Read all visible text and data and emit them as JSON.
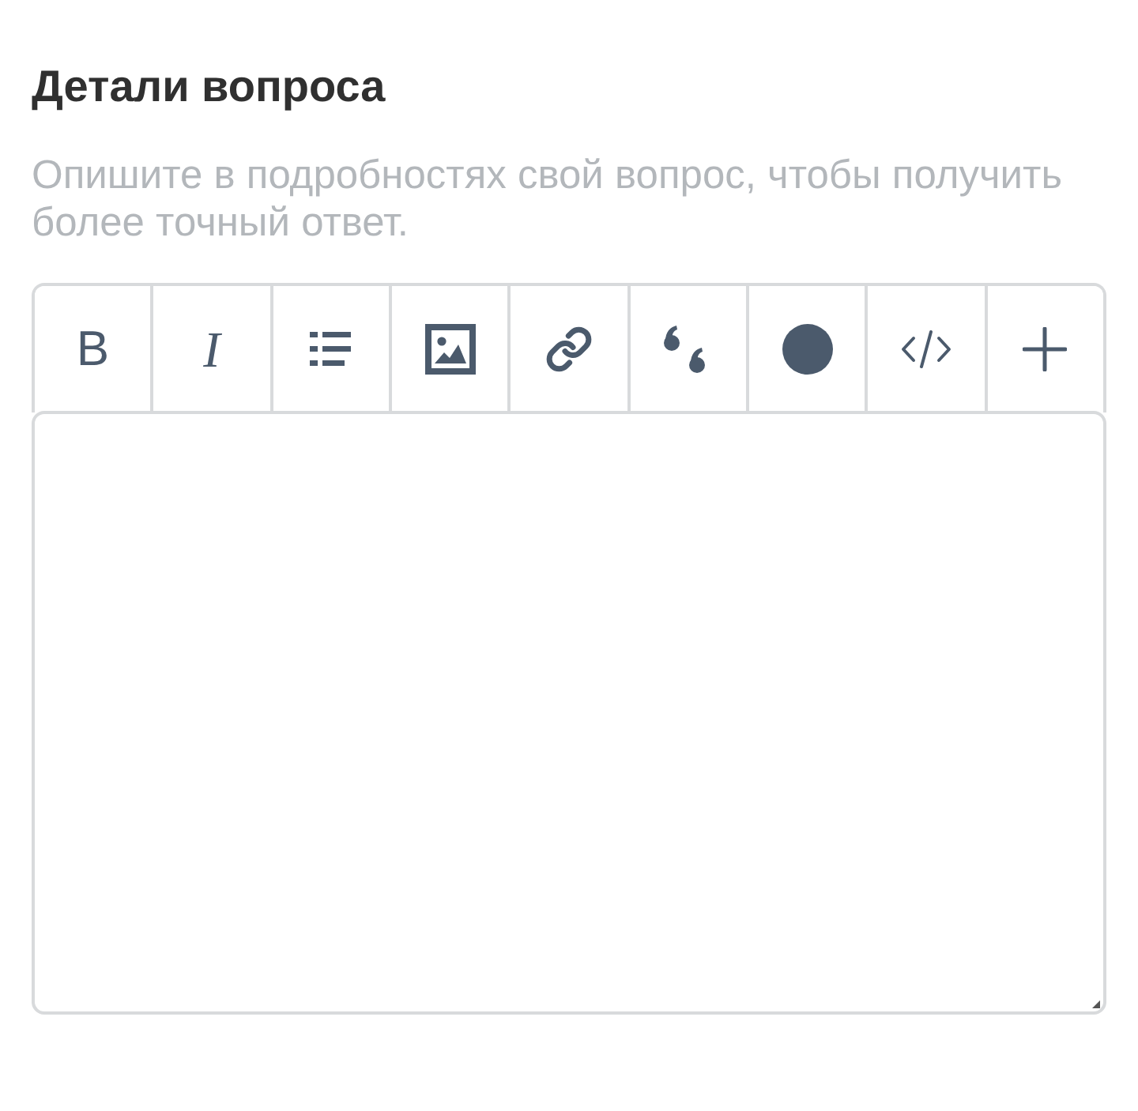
{
  "question": {
    "title": "Детали вопроса",
    "hint": "Опишите в подробностях свой вопрос, чтобы получить более точный ответ."
  },
  "editor": {
    "toolbar": [
      {
        "kind": "bold",
        "label": "B"
      },
      {
        "kind": "italic",
        "label": "I"
      }
    ]
  }
}
